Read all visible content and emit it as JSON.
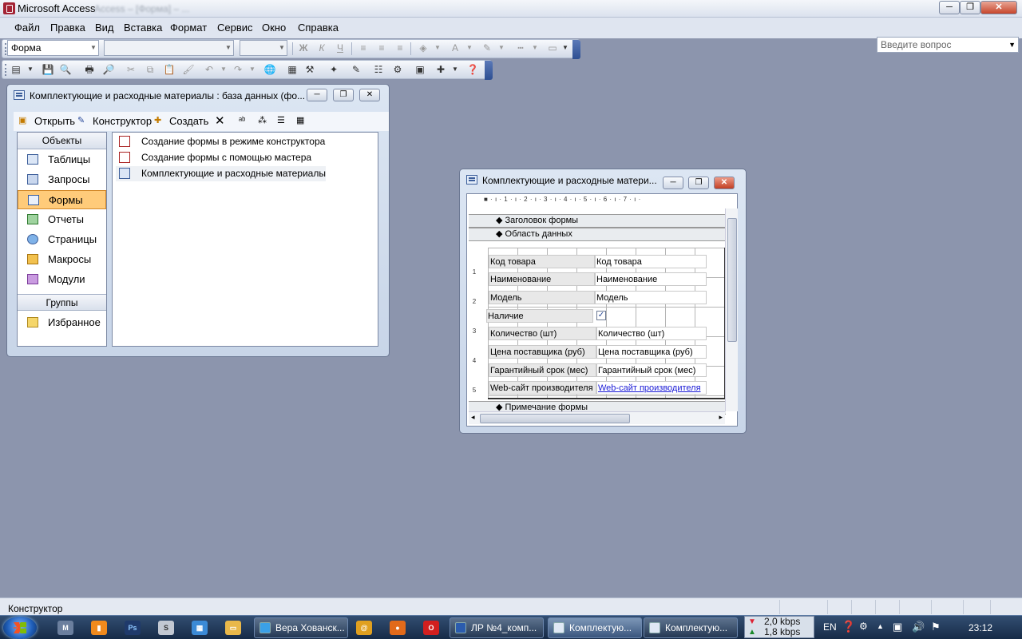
{
  "app": {
    "title": "Microsoft Access",
    "ghost_title": "Access – [Форма] – ..."
  },
  "menu": [
    "Файл",
    "Правка",
    "Вид",
    "Вставка",
    "Формат",
    "Сервис",
    "Окно",
    "Справка"
  ],
  "help_placeholder": "Введите вопрос",
  "formatting": {
    "object_combo": "Форма",
    "font_combo": "",
    "size_combo": ""
  },
  "dbwindow": {
    "title": "Комплектующие и расходные материалы : база данных (фо...",
    "toolbar": {
      "open": "Открыть",
      "design": "Конструктор",
      "create": "Создать"
    },
    "objects_header": "Объекты",
    "objects": [
      "Таблицы",
      "Запросы",
      "Формы",
      "Отчеты",
      "Страницы",
      "Макросы",
      "Модули"
    ],
    "selected_object": "Формы",
    "groups_header": "Группы",
    "groups": [
      "Избранное"
    ],
    "list": [
      "Создание формы в режиме конструктора",
      "Создание формы с помощью мастера",
      "Комплектующие и расходные материалы"
    ]
  },
  "formwindow": {
    "title": "Комплектующие и расходные матери...",
    "ruler": "■ · ı · 1 · ı · 2 · ı · 3 · ı · 4 · ı · 5 · ı · 6 · ı · 7 · ı ·",
    "sections": {
      "header": "Заголовок формы",
      "detail": "Область данных",
      "footer": "Примечание формы"
    },
    "vruler": [
      "1",
      "2",
      "3",
      "4",
      "5"
    ],
    "fields": [
      {
        "label": "Код товара",
        "value": "Код товара"
      },
      {
        "label": "Наименование",
        "value": "Наименование"
      },
      {
        "label": "Модель",
        "value": "Модель"
      },
      {
        "label": "Наличие",
        "value": ""
      },
      {
        "label": "Количество (шт)",
        "value": "Количество (шт)"
      },
      {
        "label": "Цена поставщика (руб)",
        "value": "Цена поставщика (руб)"
      },
      {
        "label": "Гарантийный срок (мес)",
        "value": "Гарантийный срок (мес)"
      },
      {
        "label": "Web-сайт производителя",
        "value": "Web-сайт производителя"
      }
    ]
  },
  "status": "Конструктор",
  "taskbar": {
    "tasks": [
      "Вера Хованск...",
      "ЛР №4_комп...",
      "Комплектую...",
      "Комплектую..."
    ],
    "net_down": "2,0 kbps",
    "net_up": "1,8 kbps",
    "lang": "EN",
    "time": "23:12"
  }
}
